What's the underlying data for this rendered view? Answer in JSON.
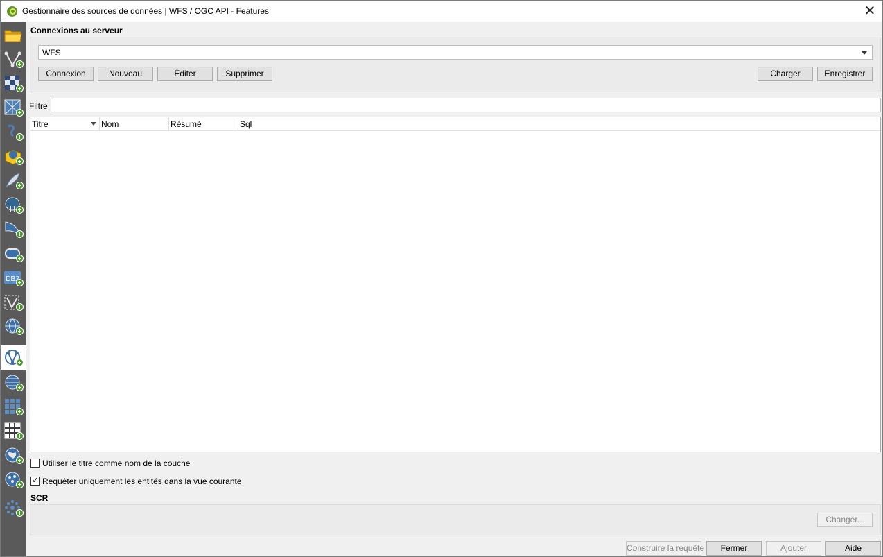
{
  "window": {
    "title": "Gestionnaire des sources de données | WFS / OGC API - Features",
    "close_glyph": "✕"
  },
  "sidebar": {
    "items": [
      {
        "icon": "folder-icon",
        "active": false
      },
      {
        "icon": "vector-layer-icon",
        "active": false
      },
      {
        "icon": "raster-layer-icon",
        "active": false
      },
      {
        "icon": "mesh-layer-icon",
        "active": false
      },
      {
        "icon": "delimited-text-icon",
        "active": false
      },
      {
        "icon": "geopackage-icon",
        "active": false
      },
      {
        "icon": "spatialite-icon",
        "active": false
      },
      {
        "icon": "postgresql-icon",
        "active": false
      },
      {
        "icon": "mssql-icon",
        "active": false
      },
      {
        "icon": "oracle-icon",
        "active": false
      },
      {
        "icon": "db2-icon",
        "label": "DB2",
        "active": false
      },
      {
        "icon": "virtual-layer-icon",
        "active": false
      },
      {
        "icon": "wms-wmts-icon",
        "active": false
      },
      {
        "icon": "wfs-icon",
        "active": true
      },
      {
        "icon": "wcs-icon",
        "active": false
      },
      {
        "icon": "xyz-tiles-icon",
        "active": false
      },
      {
        "icon": "vector-tiles-icon",
        "active": false
      },
      {
        "icon": "arcgis-mapserver-icon",
        "active": false
      },
      {
        "icon": "arcgis-featureserver-icon",
        "active": false
      },
      {
        "icon": "geonode-icon",
        "active": false
      }
    ]
  },
  "connections": {
    "label": "Connexions au serveur",
    "selected": "WFS",
    "buttons": {
      "connect": "Connexion",
      "new": "Nouveau",
      "edit": "Éditer",
      "delete": "Supprimer",
      "load": "Charger",
      "save": "Enregistrer"
    }
  },
  "filter": {
    "label": "Filtre",
    "value": ""
  },
  "table": {
    "columns": [
      "Titre",
      "Nom",
      "Résumé",
      "Sql"
    ],
    "rows": []
  },
  "options": {
    "use_title": {
      "label": "Utiliser le titre comme nom de la couche",
      "checked": false
    },
    "only_extent": {
      "label": "Requêter uniquement les entités dans la vue courante",
      "checked": true
    }
  },
  "crs": {
    "label": "SCR",
    "change_button": "Changer..."
  },
  "footer": {
    "build_query": "Construire la requête",
    "close": "Fermer",
    "add": "Ajouter",
    "help": "Aide"
  }
}
